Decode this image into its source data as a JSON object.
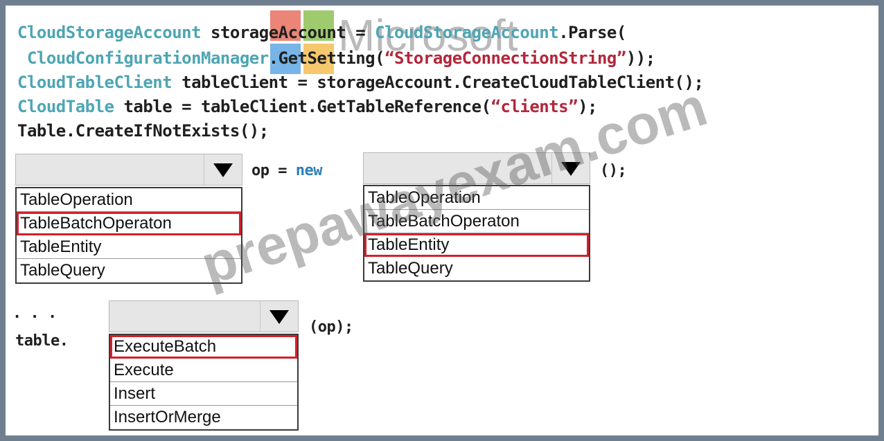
{
  "code": {
    "line1": {
      "cls1": "CloudStorageAccount",
      "mid": " storageAccount = ",
      "cls2": "CloudStorageAccount",
      "end": ".Parse("
    },
    "line2": {
      "cls": " CloudConfigurationManager",
      "mid": ".GetSetting(",
      "str": "“StorageConnectionString”",
      "end": "));"
    },
    "line3": {
      "cls": "CloudTableClient",
      "end": " tableClient = storageAccount.CreateCloudTableClient();"
    },
    "line4": {
      "cls": "CloudTable",
      "mid": " table = tableClient.GetTableReference(",
      "str": "“clients”",
      "end": ");"
    },
    "line5": "Table.CreateIfNotExists();",
    "line6": {
      "op": "op = ",
      "kw": "new"
    },
    "paren_end": "();",
    "dots": ". . .",
    "table_prefix": "table.",
    "op_call": "(op);"
  },
  "dropdowns": [
    {
      "id": "dropdown1",
      "selected_value": "",
      "options": [
        "TableOperation",
        "TableBatchOperaton",
        "TableEntity",
        "TableQuery"
      ],
      "highlighted": "TableBatchOperaton"
    },
    {
      "id": "dropdown2",
      "selected_value": "",
      "options": [
        "TableOperation",
        "TableBatchOperaton",
        "TableEntity",
        "TableQuery"
      ],
      "highlighted": "TableEntity"
    },
    {
      "id": "dropdown3",
      "selected_value": "",
      "options": [
        "ExecuteBatch",
        "Execute",
        "Insert",
        "InsertOrMerge"
      ],
      "highlighted": "ExecuteBatch"
    }
  ],
  "watermarks": {
    "logo_text": "Microsoft",
    "site_a": "prepawayexam",
    "site_b": ".com"
  },
  "colors": {
    "highlight": "#d4202b",
    "class_name": "#4ea5b3",
    "string": "#b3263a",
    "keyword": "#2e7fb5"
  }
}
